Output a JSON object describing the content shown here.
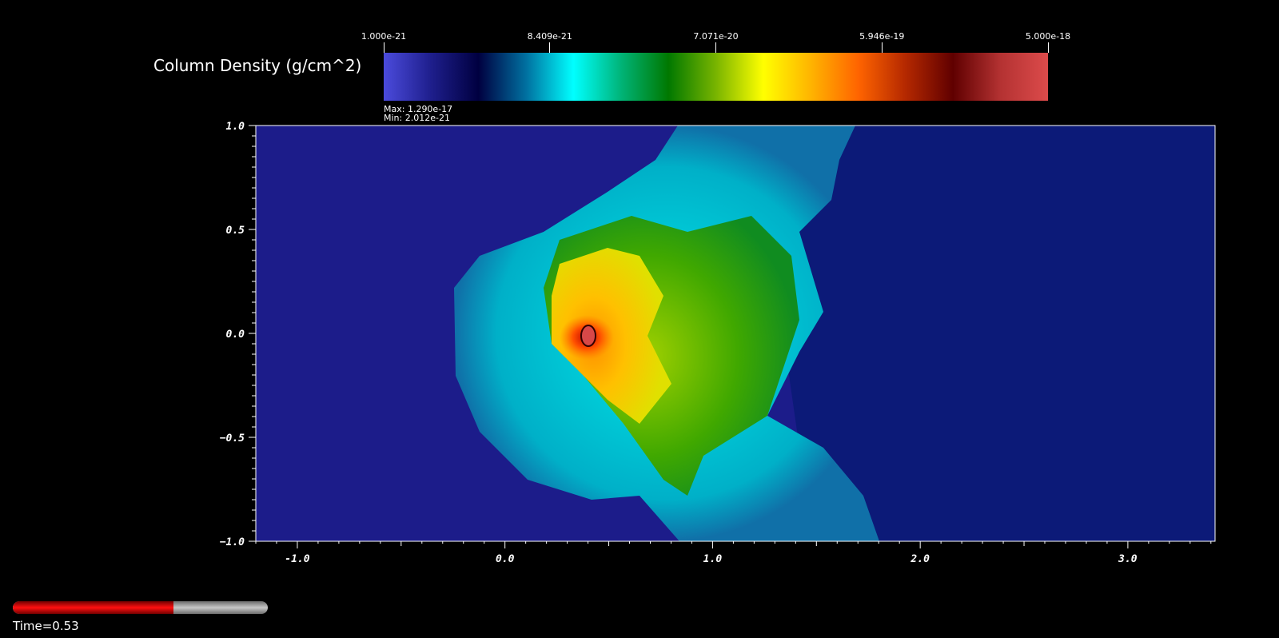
{
  "chart_data": {
    "type": "heatmap",
    "title": "Column Density (g/cm^2)",
    "colorbar": {
      "tick_labels": [
        "1.000e-21",
        "8.409e-21",
        "7.071e-20",
        "5.946e-19",
        "5.000e-18"
      ],
      "max_label": "Max:  1.290e-17",
      "min_label": "Min:  2.012e-21",
      "colors": [
        "#4b4bdc",
        "#1e1e8c",
        "#000040",
        "#0070a0",
        "#00ffff",
        "#00b478",
        "#007800",
        "#78b400",
        "#ffff00",
        "#ffb400",
        "#ff6400",
        "#b42800",
        "#600000",
        "#b43232",
        "#dc4b4b"
      ]
    },
    "x_ticks": [
      -1.0,
      0.0,
      1.0,
      2.0,
      3.0
    ],
    "x_tick_labels": [
      "-1.0",
      "0.0",
      "1.0",
      "2.0",
      "3.0"
    ],
    "y_ticks": [
      1.0,
      0.5,
      0.0,
      -0.5,
      -1.0
    ],
    "y_tick_labels": [
      "1.0",
      "0.5",
      "0.0",
      "−0.5",
      "−1.0"
    ],
    "xlim": [
      -1.2,
      3.42
    ],
    "ylim": [
      -1.0,
      1.0
    ],
    "background_color": "#1c1c8a",
    "time_progress": 0.63
  },
  "time_label": "Time=0.53"
}
